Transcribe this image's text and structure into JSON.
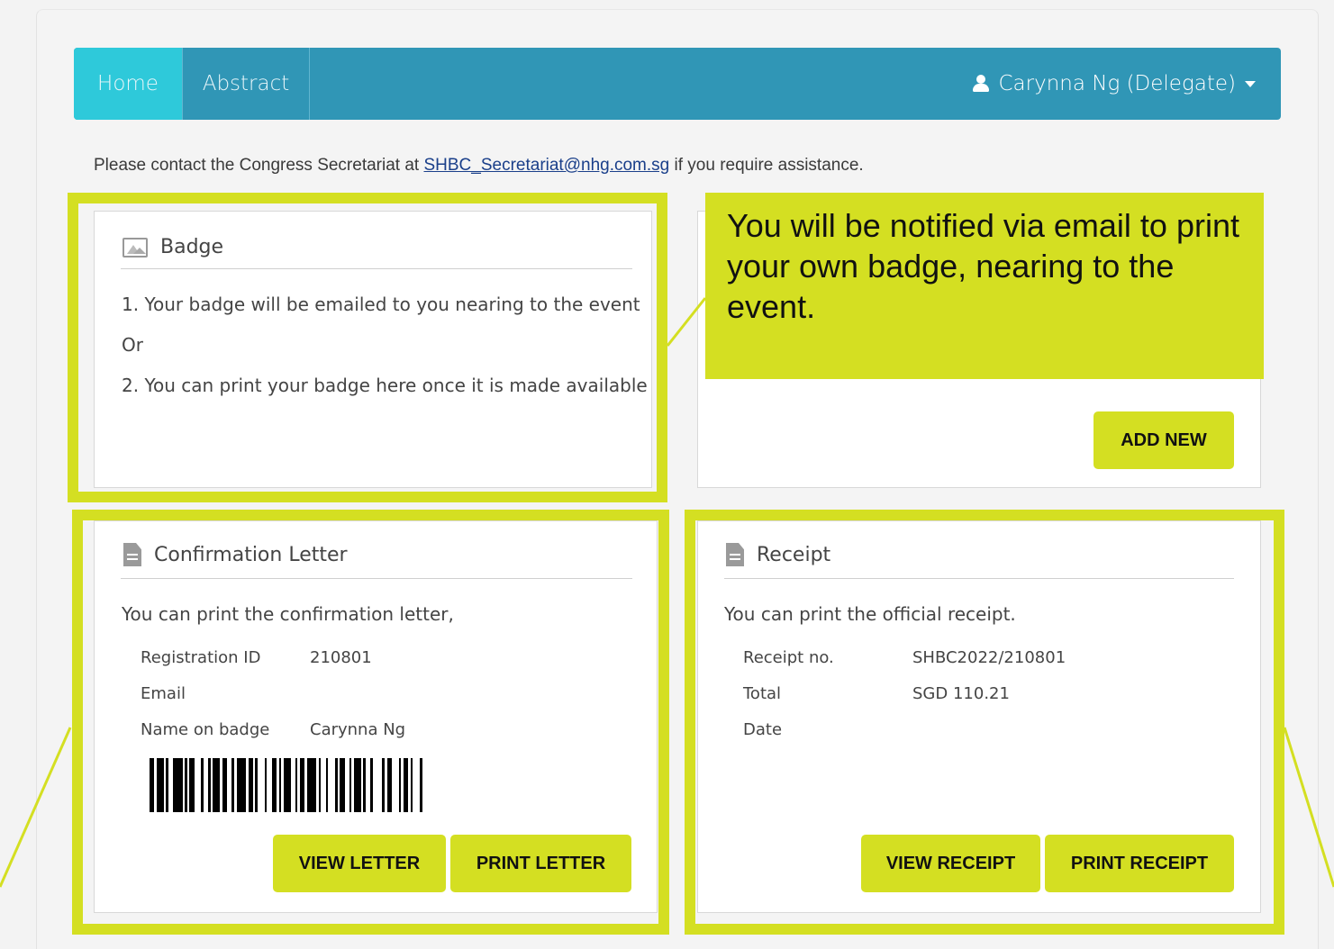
{
  "nav": {
    "home": "Home",
    "abstract": "Abstract",
    "user": "Carynna Ng (Delegate)"
  },
  "notice": {
    "prefix": "Please contact the Congress Secretariat at ",
    "email": "SHBC_Secretariat@nhg.com.sg",
    "suffix": " if you require assistance."
  },
  "badge": {
    "title": "Badge",
    "line1": "1. Your badge will be emailed to you nearing to the event",
    "or": "Or",
    "line2": "2. You can print your badge here once it is made available"
  },
  "callout": {
    "text": "You will be notified via email to print your own badge, nearing to the event."
  },
  "add_new": {
    "label": "ADD NEW"
  },
  "confirmation": {
    "title": "Confirmation Letter",
    "intro": "You can print the confirmation letter,",
    "fields": [
      {
        "label": "Registration ID",
        "value": "210801"
      },
      {
        "label": "Email",
        "value": ""
      },
      {
        "label": "Name on badge",
        "value": "Carynna Ng"
      }
    ],
    "view_label": "VIEW LETTER",
    "print_label": "PRINT LETTER"
  },
  "receipt": {
    "title": "Receipt",
    "intro": "You can print the official receipt.",
    "fields": [
      {
        "label": "Receipt no.",
        "value": "SHBC2022/210801"
      },
      {
        "label": "Total",
        "value": "SGD 110.21"
      },
      {
        "label": "Date",
        "value": ""
      }
    ],
    "view_label": "VIEW RECEIPT",
    "print_label": "PRINT RECEIPT"
  },
  "colors": {
    "nav": "#3096b6",
    "nav_active": "#2ec9da",
    "highlight": "#d4df22"
  }
}
